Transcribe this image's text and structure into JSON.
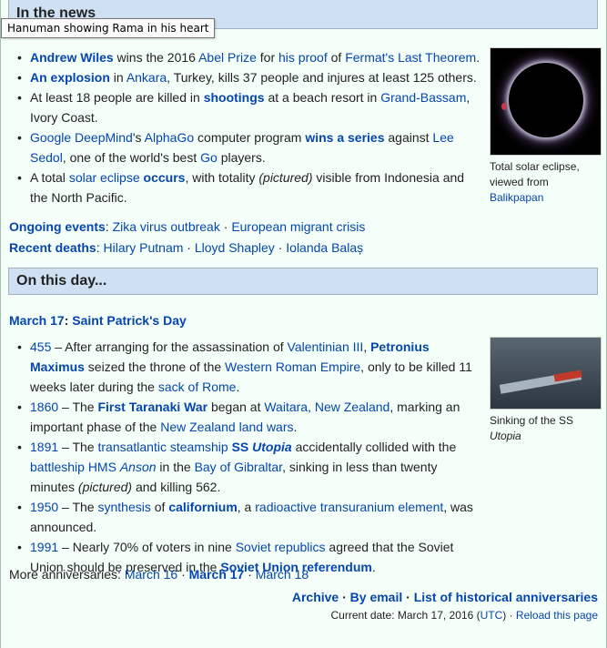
{
  "tooltip": "Hanuman showing Rama in his heart",
  "news": {
    "heading": "In the news",
    "items": [
      {
        "parts": [
          {
            "t": "Andrew Wiles",
            "link": true,
            "bold": true
          },
          {
            "t": " wins the 2016 "
          },
          {
            "t": "Abel Prize",
            "link": true
          },
          {
            "t": " for "
          },
          {
            "t": "his proof",
            "link": true
          },
          {
            "t": " of "
          },
          {
            "t": "Fermat's Last Theorem",
            "link": true
          },
          {
            "t": "."
          }
        ]
      },
      {
        "parts": [
          {
            "t": "An explosion",
            "link": true,
            "bold": true
          },
          {
            "t": " in "
          },
          {
            "t": "Ankara",
            "link": true
          },
          {
            "t": ", Turkey, kills 37 people and injures at least 125 others."
          }
        ]
      },
      {
        "parts": [
          {
            "t": "At least 18 people are killed in "
          },
          {
            "t": "shootings",
            "link": true,
            "bold": true
          },
          {
            "t": " at a beach resort in "
          },
          {
            "t": "Grand-Bassam",
            "link": true
          },
          {
            "t": ", Ivory Coast."
          }
        ]
      },
      {
        "parts": [
          {
            "t": "Google DeepMind",
            "link": true
          },
          {
            "t": "'s "
          },
          {
            "t": "AlphaGo",
            "link": true
          },
          {
            "t": " computer program "
          },
          {
            "t": "wins a series",
            "link": true,
            "bold": true
          },
          {
            "t": " against "
          },
          {
            "t": "Lee Sedol",
            "link": true
          },
          {
            "t": ", one of the world's best "
          },
          {
            "t": "Go",
            "link": true
          },
          {
            "t": " players."
          }
        ]
      },
      {
        "parts": [
          {
            "t": "A total "
          },
          {
            "t": "solar eclipse",
            "link": true
          },
          {
            "t": " "
          },
          {
            "t": "occurs",
            "link": true,
            "bold": true
          },
          {
            "t": ", with totality "
          },
          {
            "t": "(pictured)",
            "italic": true
          },
          {
            "t": " visible from Indonesia and the North Pacific."
          }
        ]
      }
    ],
    "image_caption_1": "Total solar eclipse, viewed from",
    "image_caption_link": "Balikpapan",
    "ongoing_label": "Ongoing events",
    "ongoing": [
      "Zika virus outbreak",
      "European migrant crisis"
    ],
    "deaths_label": "Recent deaths",
    "deaths": [
      "Hilary Putnam",
      "Lloyd Shapley",
      "Iolanda Balaș"
    ]
  },
  "onthisday": {
    "heading": "On this day...",
    "date_link": "March 17",
    "date_sep": ": ",
    "date_event": "Saint Patrick's Day",
    "items": [
      {
        "parts": [
          {
            "t": "455",
            "link": true
          },
          {
            "t": " – After arranging for the assassination of "
          },
          {
            "t": "Valentinian III",
            "link": true
          },
          {
            "t": ", "
          },
          {
            "t": "Petronius Maximus",
            "link": true,
            "bold": true
          },
          {
            "t": " seized the throne of the "
          },
          {
            "t": "Western Roman Empire",
            "link": true
          },
          {
            "t": ", only to be killed 11 weeks later during the "
          },
          {
            "t": "sack of Rome",
            "link": true
          },
          {
            "t": "."
          }
        ]
      },
      {
        "parts": [
          {
            "t": "1860",
            "link": true
          },
          {
            "t": " – The "
          },
          {
            "t": "First Taranaki War",
            "link": true,
            "bold": true
          },
          {
            "t": " began at "
          },
          {
            "t": "Waitara, New Zealand",
            "link": true
          },
          {
            "t": ", marking an important phase of the "
          },
          {
            "t": "New Zealand land wars",
            "link": true
          },
          {
            "t": "."
          }
        ]
      },
      {
        "parts": [
          {
            "t": "1891",
            "link": true
          },
          {
            "t": " – The "
          },
          {
            "t": "transatlantic steamship",
            "link": true
          },
          {
            "t": " "
          },
          {
            "t": "SS ",
            "link": true,
            "bold": true
          },
          {
            "t": "Utopia",
            "link": true,
            "bold": true,
            "italic": true
          },
          {
            "t": " accidentally collided with the "
          },
          {
            "t": "battleship HMS ",
            "link": true
          },
          {
            "t": "Anson",
            "link": true,
            "italic": true
          },
          {
            "t": " in the "
          },
          {
            "t": "Bay of Gibraltar",
            "link": true
          },
          {
            "t": ", sinking in less than twenty minutes "
          },
          {
            "t": "(pictured)",
            "italic": true
          },
          {
            "t": " and killing 562."
          }
        ]
      },
      {
        "parts": [
          {
            "t": "1950",
            "link": true
          },
          {
            "t": " – The "
          },
          {
            "t": "synthesis",
            "link": true
          },
          {
            "t": " of "
          },
          {
            "t": "californium",
            "link": true,
            "bold": true
          },
          {
            "t": ", a "
          },
          {
            "t": "radioactive",
            "link": true
          },
          {
            "t": " "
          },
          {
            "t": "transuranium element",
            "link": true
          },
          {
            "t": ", was announced."
          }
        ]
      },
      {
        "parts": [
          {
            "t": "1991",
            "link": true
          },
          {
            "t": " – Nearly 70% of voters in nine "
          },
          {
            "t": "Soviet republics",
            "link": true
          },
          {
            "t": " agreed that the Soviet Union should be preserved in the "
          },
          {
            "t": "Soviet Union referendum",
            "link": true,
            "bold": true
          },
          {
            "t": "."
          }
        ]
      }
    ],
    "image_caption_1": "Sinking of the SS",
    "image_caption_2": "Utopia",
    "more_label": "More anniversaries: ",
    "more": [
      {
        "t": "March 16",
        "bold": false
      },
      {
        "t": "March 17",
        "bold": true
      },
      {
        "t": "March 18",
        "bold": false
      }
    ],
    "footer": [
      "Archive",
      "By email",
      "List of historical anniversaries"
    ],
    "current_date_label": "Current date: March 17, 2016 (",
    "utc": "UTC",
    "current_date_close": ") · ",
    "reload": "Reload this page"
  }
}
